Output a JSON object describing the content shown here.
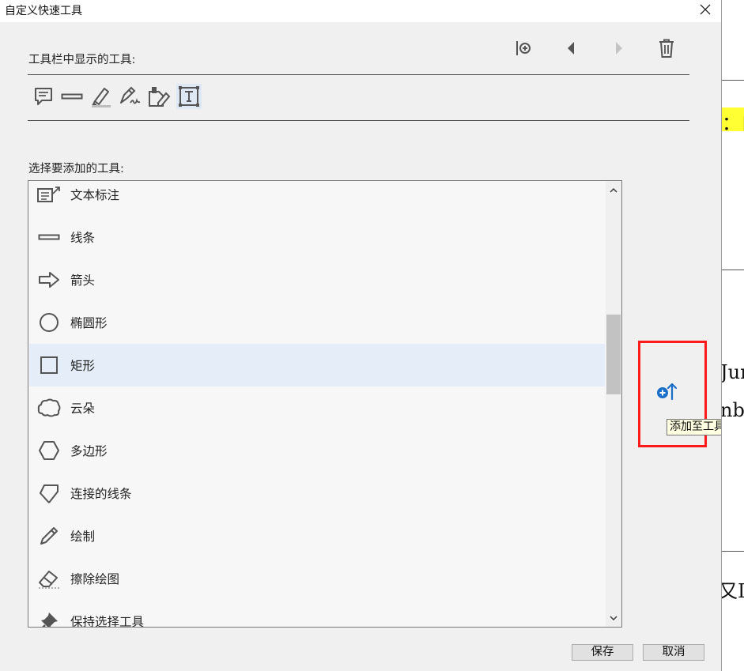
{
  "dialog": {
    "title": "自定义快速工具",
    "close_glyph": "✕",
    "shown_label": "工具栏中显示的工具:",
    "add_label": "选择要添加的工具:",
    "toolbar_actions": [
      "insert-separator",
      "move-left",
      "move-right",
      "delete"
    ],
    "shown_tools": [
      "comment-icon",
      "line-icon",
      "highlighter-icon",
      "signature-icon",
      "stamp-icon",
      "text-box-icon"
    ],
    "selected_shown_tool": "text-box-icon",
    "tool_list": [
      {
        "label": "文本标注",
        "icon": "callout-icon",
        "selected": false
      },
      {
        "label": "线条",
        "icon": "line-icon",
        "selected": false
      },
      {
        "label": "箭头",
        "icon": "arrow-icon",
        "selected": false
      },
      {
        "label": "椭圆形",
        "icon": "ellipse-icon",
        "selected": false
      },
      {
        "label": "矩形",
        "icon": "rectangle-icon",
        "selected": true
      },
      {
        "label": "云朵",
        "icon": "cloud-icon",
        "selected": false
      },
      {
        "label": "多边形",
        "icon": "polygon-icon",
        "selected": false
      },
      {
        "label": "连接的线条",
        "icon": "polyline-icon",
        "selected": false
      },
      {
        "label": "绘制",
        "icon": "pencil-icon",
        "selected": false
      },
      {
        "label": "擦除绘图",
        "icon": "eraser-icon",
        "selected": false
      },
      {
        "label": "保持选择工具",
        "icon": "pin-icon",
        "selected": false
      }
    ],
    "add_tooltip": "添加至工具栏",
    "save_label": "保存",
    "cancel_label": "取消",
    "highlight_color": "#ff1a1a",
    "selected_row_color": "#e5eef8",
    "accent_color": "#1a6fc9"
  },
  "background_doc": {
    "texts": [
      "：自",
      "Jur",
      "nbe",
      "又I"
    ],
    "highlight_color": "#ffff33"
  }
}
